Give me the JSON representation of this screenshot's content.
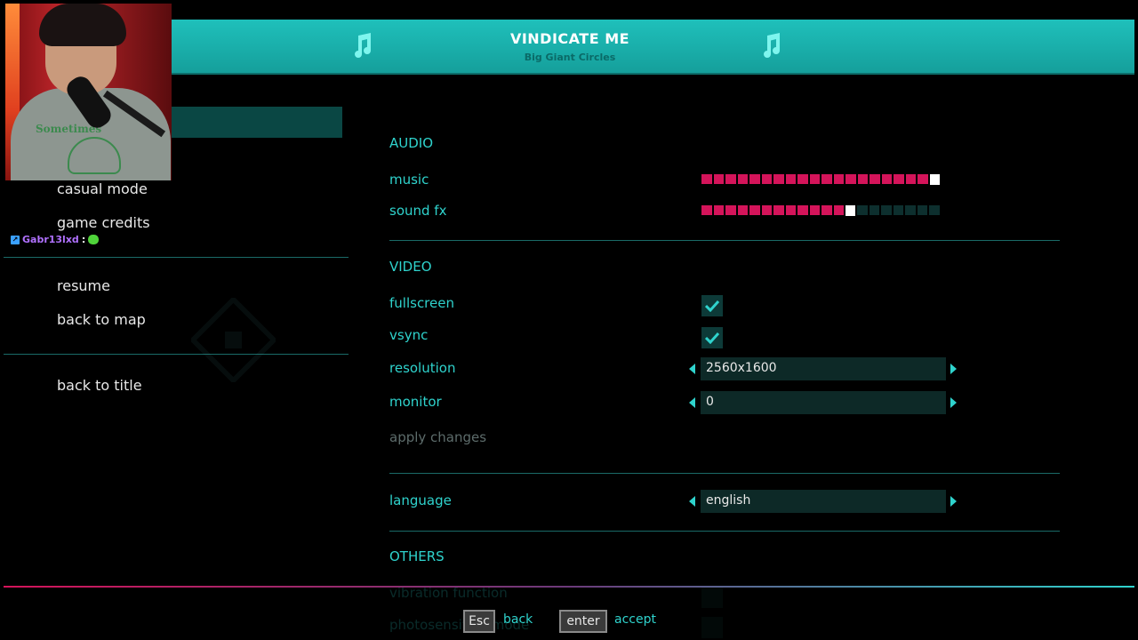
{
  "song": {
    "title": "VINDICATE ME",
    "artist": "Big Giant Circles",
    "icon": "music-note-icon"
  },
  "left_menu": {
    "items_group1": [
      "casual mode",
      "game credits"
    ],
    "items_group2": [
      "resume",
      "back to map"
    ],
    "items_group3": [
      "back to title"
    ]
  },
  "chat": {
    "username": "Gabr13lxd",
    "separator": ":"
  },
  "webcam": {
    "shirt_text": "Sometimes"
  },
  "settings": {
    "audio": {
      "title": "AUDIO",
      "music_label": "music",
      "music_level": 20,
      "music_max": 20,
      "sfx_label": "sound fx",
      "sfx_level": 13,
      "sfx_max": 20
    },
    "video": {
      "title": "VIDEO",
      "fullscreen_label": "fullscreen",
      "fullscreen_checked": true,
      "vsync_label": "vsync",
      "vsync_checked": true,
      "resolution_label": "resolution",
      "resolution_value": "2560x1600",
      "monitor_label": "monitor",
      "monitor_value": "0",
      "apply_label": "apply changes"
    },
    "language": {
      "label": "language",
      "value": "english"
    },
    "others": {
      "title": "OTHERS",
      "vibration_label": "vibration function",
      "photosensitive_label": "photosensitive mode"
    }
  },
  "key_hints": {
    "back_key": "Esc",
    "back_label": "back",
    "accept_key": "enter",
    "accept_label": "accept"
  },
  "colors": {
    "accent": "#2fd3cd",
    "bar_on": "#d4145a",
    "bar_off": "#0d2f2e",
    "banner": "#1fc0bb"
  }
}
